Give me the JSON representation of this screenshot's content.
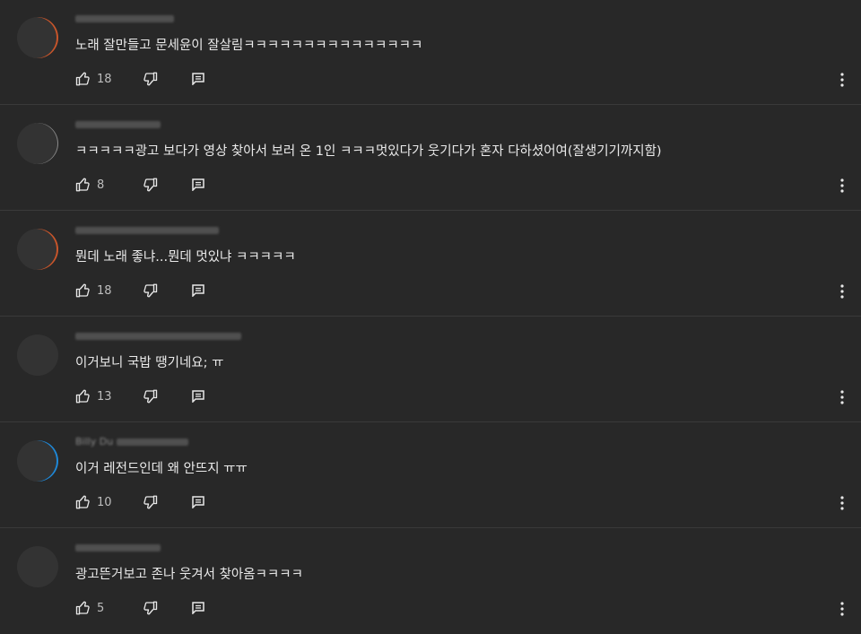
{
  "comments": [
    {
      "author_fragment": "",
      "text": "노래 잘만들고 문세윤이 잘살림ㅋㅋㅋㅋㅋㅋㅋㅋㅋㅋㅋㅋㅋㅋㅋ",
      "likes": "18"
    },
    {
      "author_fragment": "",
      "text": "ㅋㅋㅋㅋㅋ광고 보다가 영상 찾아서 보러 온 1인 ㅋㅋㅋ멋있다가 웃기다가 혼자 다하셨어여(잘생기기까지함)",
      "likes": "8"
    },
    {
      "author_fragment": "",
      "text": "뭔데 노래 좋냐...뭔데 멋있냐 ㅋㅋㅋㅋㅋ",
      "likes": "18"
    },
    {
      "author_fragment": "",
      "text": "이거보니 국밥 땡기네요; ㅠ",
      "likes": "13"
    },
    {
      "author_fragment": "Billy Du",
      "text": "이거 레전드인데 왜 안뜨지 ㅠㅠ",
      "likes": "10"
    },
    {
      "author_fragment": "",
      "text": "광고뜬거보고 존나 웃겨서 찾아옴ㅋㅋㅋㅋ",
      "likes": "5"
    }
  ],
  "icons": {
    "like": "thumbs-up-outline",
    "dislike": "thumbs-down-outline",
    "reply": "reply-comment",
    "more": "vertical-ellipsis"
  },
  "colors": {
    "background": "#282828",
    "text": "#eaeaea",
    "muted": "#bdbdbd",
    "divider": "#3a3a3a"
  }
}
